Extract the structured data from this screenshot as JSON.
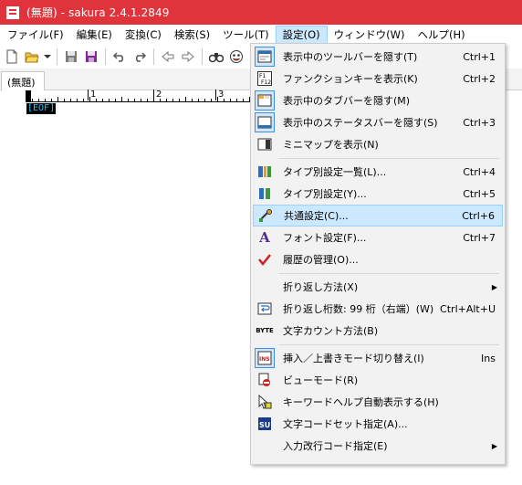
{
  "window": {
    "title": "(無題) - sakura 2.4.1.2849"
  },
  "menubar": {
    "items": [
      {
        "label": "ファイル(F)"
      },
      {
        "label": "編集(E)"
      },
      {
        "label": "変換(C)"
      },
      {
        "label": "検索(S)"
      },
      {
        "label": "ツール(T)"
      },
      {
        "label": "設定(O)"
      },
      {
        "label": "ウィンドウ(W)"
      },
      {
        "label": "ヘルプ(H)"
      }
    ]
  },
  "toolbar": {
    "buttons": [
      "new-file-icon",
      "open-file-icon",
      "dropdown-arrow-icon",
      "save-icon",
      "save-all-icon",
      "undo-icon",
      "redo-icon",
      "back-icon",
      "forward-icon",
      "binoculars-icon",
      "smiley-icon"
    ]
  },
  "tabs": {
    "active_label": "(無題)"
  },
  "editor": {
    "ruler_labels": [
      "1",
      "2",
      "3"
    ],
    "eof_text": "[EOF]"
  },
  "settings_menu": {
    "items": [
      {
        "label": "表示中のツールバーを隠す(T)",
        "shortcut": "Ctrl+1",
        "icon": "toolbar-icon"
      },
      {
        "label": "ファンクションキーを表示(K)",
        "shortcut": "Ctrl+2",
        "icon": "function-key-icon"
      },
      {
        "label": "表示中のタブバーを隠す(M)",
        "shortcut": "",
        "icon": "tabbar-icon"
      },
      {
        "label": "表示中のステータスバーを隠す(S)",
        "shortcut": "Ctrl+3",
        "icon": "statusbar-icon"
      },
      {
        "label": "ミニマップを表示(N)",
        "shortcut": "",
        "icon": "minimap-icon"
      },
      {
        "label": "タイプ別設定一覧(L)...",
        "shortcut": "Ctrl+4",
        "icon": "type-settings-list-icon"
      },
      {
        "label": "タイプ別設定(Y)...",
        "shortcut": "Ctrl+5",
        "icon": "type-settings-icon"
      },
      {
        "label": "共通設定(C)...",
        "shortcut": "Ctrl+6",
        "icon": "common-settings-icon"
      },
      {
        "label": "フォント設定(F)...",
        "shortcut": "Ctrl+7",
        "icon": "font-icon"
      },
      {
        "label": "履歴の管理(O)...",
        "shortcut": "",
        "icon": "history-icon"
      },
      {
        "label": "折り返し方法(X)",
        "shortcut": "",
        "icon": ""
      },
      {
        "label": "折り返し桁数: 99 桁（右端）(W)",
        "shortcut": "Ctrl+Alt+U",
        "icon": "wrap-icon"
      },
      {
        "label": "文字カウント方法(B)",
        "shortcut": "",
        "icon": "byte-icon"
      },
      {
        "label": "挿入／上書きモード切り替え(I)",
        "shortcut": "Ins",
        "icon": "insert-mode-icon"
      },
      {
        "label": "ビューモード(R)",
        "shortcut": "",
        "icon": "view-mode-icon"
      },
      {
        "label": "キーワードヘルプ自動表示する(H)",
        "shortcut": "",
        "icon": "keyword-help-icon"
      },
      {
        "label": "文字コードセット指定(A)...",
        "shortcut": "",
        "icon": "charset-icon"
      },
      {
        "label": "入力改行コード指定(E)",
        "shortcut": "",
        "icon": ""
      }
    ],
    "byte_icon_text": "BYTE",
    "font_icon_text": "A",
    "su_icon_text": "SU",
    "fkey_icon_text": "F1 F12",
    "ins_icon_text": "INS"
  },
  "colors": {
    "titlebar": "#e0333c",
    "hover": "#cce8ff",
    "eof": "#22c6ff"
  }
}
